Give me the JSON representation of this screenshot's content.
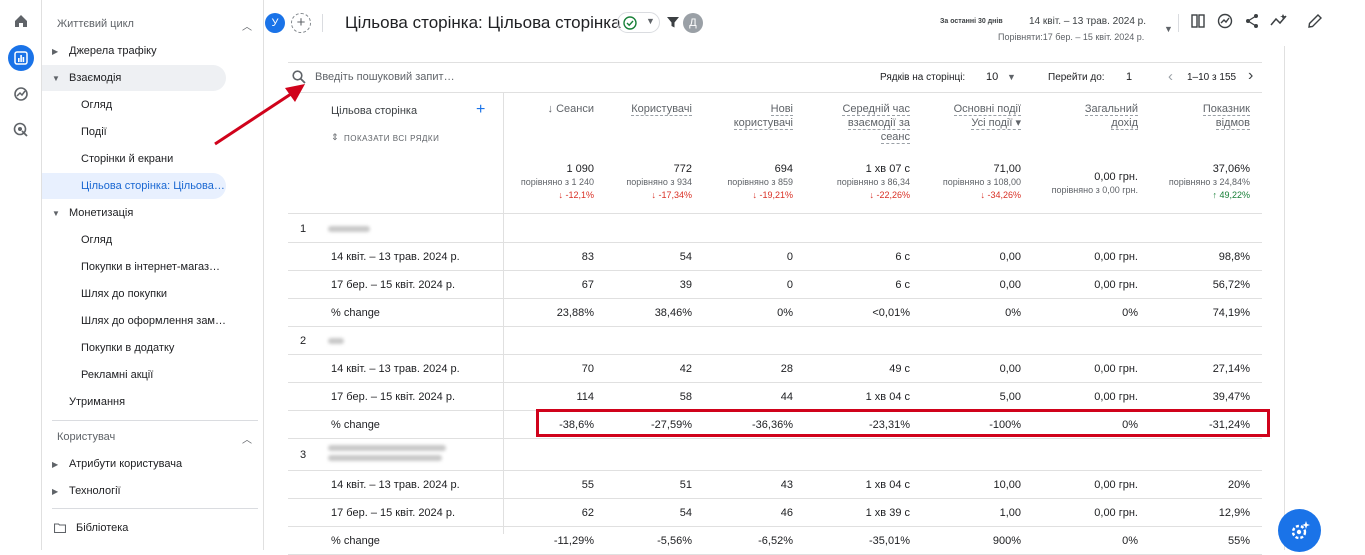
{
  "app": {
    "title": "Цільова сторінка: Цільова сторінка",
    "avatar_letter": "У",
    "filter_avatar": "Д",
    "date_label": "За останні 30 днів",
    "date_range": "14 квіт. – 13 трав. 2024 р.",
    "compare_range": "Порівняти:17 бер. – 15 квіт. 2024 р."
  },
  "nav": {
    "lifecycle_header": "Життєвий цикл",
    "items": [
      {
        "label": "Джерела трафіку"
      },
      {
        "label": "Взаємодія"
      },
      {
        "label": "Огляд"
      },
      {
        "label": "Події"
      },
      {
        "label": "Сторінки й екрани"
      },
      {
        "label": "Цільова сторінка: Цільова…"
      },
      {
        "label": "Монетизація"
      },
      {
        "label": "Огляд"
      },
      {
        "label": "Покупки в інтернет-магаз…"
      },
      {
        "label": "Шлях до покупки"
      },
      {
        "label": "Шлях до оформлення зам…"
      },
      {
        "label": "Покупки в додатку"
      },
      {
        "label": "Рекламні акції"
      },
      {
        "label": "Утримання"
      }
    ],
    "user_header": "Користувач",
    "user_items": [
      {
        "label": "Атрибути користувача"
      },
      {
        "label": "Технології"
      }
    ],
    "library": "Бібліотека"
  },
  "toolbar": {
    "search_placeholder": "Введіть пошуковий запит…",
    "rows_label": "Рядків на сторінці:",
    "rows_value": "10",
    "goto_label": "Перейти до:",
    "goto_value": "1",
    "pagination": "1–10 з 155"
  },
  "table": {
    "dim_header": "Цільова сторінка",
    "show_all": "ПОКАЗАТИ ВСІ РЯДКИ",
    "headers": [
      {
        "l1": "↓ Сеанси",
        "l2": "",
        "l3": ""
      },
      {
        "l1": "Користувачі",
        "l2": "",
        "l3": ""
      },
      {
        "l1": "Нові",
        "l2": "користувачі",
        "l3": ""
      },
      {
        "l1": "Середній час",
        "l2": "взаємодії за",
        "l3": "сеанс"
      },
      {
        "l1": "Основні події",
        "l2": "Усі події ▾",
        "l3": ""
      },
      {
        "l1": "Загальний",
        "l2": "дохід",
        "l3": ""
      },
      {
        "l1": "Показник",
        "l2": "відмов",
        "l3": ""
      }
    ],
    "totals": [
      {
        "v": "1 090",
        "c": "порівняно з 1 240",
        "d": "↓ -12,1%",
        "dir": "down"
      },
      {
        "v": "772",
        "c": "порівняно з 934",
        "d": "↓ -17,34%",
        "dir": "down"
      },
      {
        "v": "694",
        "c": "порівняно з 859",
        "d": "↓ -19,21%",
        "dir": "down"
      },
      {
        "v": "1 хв 07 с",
        "c": "порівняно з 86,34",
        "d": "↓ -22,26%",
        "dir": "down"
      },
      {
        "v": "71,00",
        "c": "порівняно з 108,00",
        "d": "↓ -34,26%",
        "dir": "down"
      },
      {
        "v": "0,00 грн.",
        "c": "порівняно з 0,00 грн.",
        "d": "",
        "dir": ""
      },
      {
        "v": "37,06%",
        "c": "порівняно з 24,84%",
        "d": "↑ 49,22%",
        "dir": "up"
      }
    ],
    "groups": [
      {
        "idx": "1",
        "rows": [
          {
            "label": "14 квіт. – 13 трав. 2024 р.",
            "vals": [
              "83",
              "54",
              "0",
              "6 с",
              "0,00",
              "0,00 грн.",
              "98,8%"
            ]
          },
          {
            "label": "17 бер. – 15 квіт. 2024 р.",
            "vals": [
              "67",
              "39",
              "0",
              "6 с",
              "0,00",
              "0,00 грн.",
              "56,72%"
            ]
          },
          {
            "label": "% change",
            "vals": [
              "23,88%",
              "38,46%",
              "0%",
              "<0,01%",
              "0%",
              "0%",
              "74,19%"
            ]
          }
        ]
      },
      {
        "idx": "2",
        "rows": [
          {
            "label": "14 квіт. – 13 трав. 2024 р.",
            "vals": [
              "70",
              "42",
              "28",
              "49 с",
              "0,00",
              "0,00 грн.",
              "27,14%"
            ]
          },
          {
            "label": "17 бер. – 15 квіт. 2024 р.",
            "vals": [
              "114",
              "58",
              "44",
              "1 хв 04 с",
              "5,00",
              "0,00 грн.",
              "39,47%"
            ]
          },
          {
            "label": "% change",
            "vals": [
              "-38,6%",
              "-27,59%",
              "-36,36%",
              "-23,31%",
              "-100%",
              "0%",
              "-31,24%"
            ]
          }
        ]
      },
      {
        "idx": "3",
        "rows": [
          {
            "label": "14 квіт. – 13 трав. 2024 р.",
            "vals": [
              "55",
              "51",
              "43",
              "1 хв 04 с",
              "10,00",
              "0,00 грн.",
              "20%"
            ]
          },
          {
            "label": "17 бер. – 15 квіт. 2024 р.",
            "vals": [
              "62",
              "54",
              "46",
              "1 хв 39 с",
              "1,00",
              "0,00 грн.",
              "12,9%"
            ]
          },
          {
            "label": "% change",
            "vals": [
              "-11,29%",
              "-5,56%",
              "-6,52%",
              "-35,01%",
              "900%",
              "0%",
              "55%"
            ]
          }
        ]
      }
    ]
  },
  "colors": {
    "accent": "#1a73e8",
    "highlight": "#d0021b",
    "down": "#d93025",
    "up": "#188038"
  }
}
